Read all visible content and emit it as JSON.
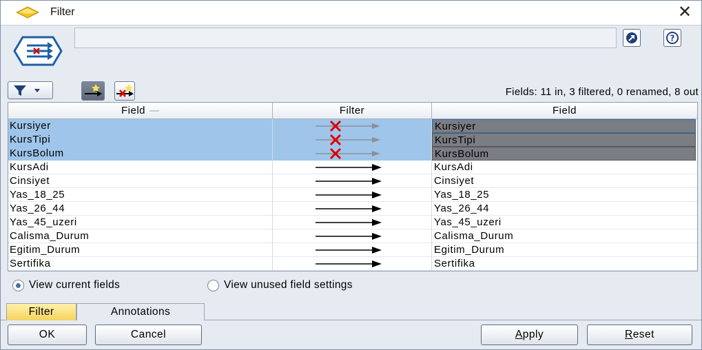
{
  "window": {
    "title": "Filter",
    "close_glyph": "✕"
  },
  "toolbar": {
    "fields_summary": "Fields: 11 in, 3 filtered, 0 renamed, 8 out"
  },
  "table": {
    "headers": [
      "Field",
      "Filter",
      "Field"
    ],
    "rows": [
      {
        "in": "Kursiyer",
        "filtered": true,
        "out": "Kursiyer",
        "selected": true
      },
      {
        "in": "KursTipi",
        "filtered": true,
        "out": "KursTipi",
        "selected": true
      },
      {
        "in": "KursBolum",
        "filtered": true,
        "out": "KursBolum",
        "selected": true
      },
      {
        "in": "KursAdi",
        "filtered": false,
        "out": "KursAdi",
        "selected": false
      },
      {
        "in": "Cinsiyet",
        "filtered": false,
        "out": "Cinsiyet",
        "selected": false
      },
      {
        "in": "Yas_18_25",
        "filtered": false,
        "out": "Yas_18_25",
        "selected": false
      },
      {
        "in": "Yas_26_44",
        "filtered": false,
        "out": "Yas_26_44",
        "selected": false
      },
      {
        "in": "Yas_45_uzeri",
        "filtered": false,
        "out": "Yas_45_uzeri",
        "selected": false
      },
      {
        "in": "Calisma_Durum",
        "filtered": false,
        "out": "Calisma_Durum",
        "selected": false
      },
      {
        "in": "Egitim_Durum",
        "filtered": false,
        "out": "Egitim_Durum",
        "selected": false
      },
      {
        "in": "Sertifika",
        "filtered": false,
        "out": "Sertifika",
        "selected": false
      }
    ]
  },
  "view_options": {
    "current_fields": "View current fields",
    "unused_settings": "View unused field settings",
    "selected": "current_fields"
  },
  "tabs": [
    {
      "label": "Filter",
      "active": true
    },
    {
      "label": "Annotations",
      "active": false
    }
  ],
  "buttons": {
    "ok": "OK",
    "cancel": "Cancel",
    "apply_mnemonic": "A",
    "apply_rest": "pply",
    "reset_mnemonic": "R",
    "reset_rest": "eset"
  },
  "colors": {
    "selection": "#9fc6ea",
    "output_selected": "#7a7d83",
    "active_tab": "#f5d35e",
    "filtered_x": "#e00000"
  }
}
